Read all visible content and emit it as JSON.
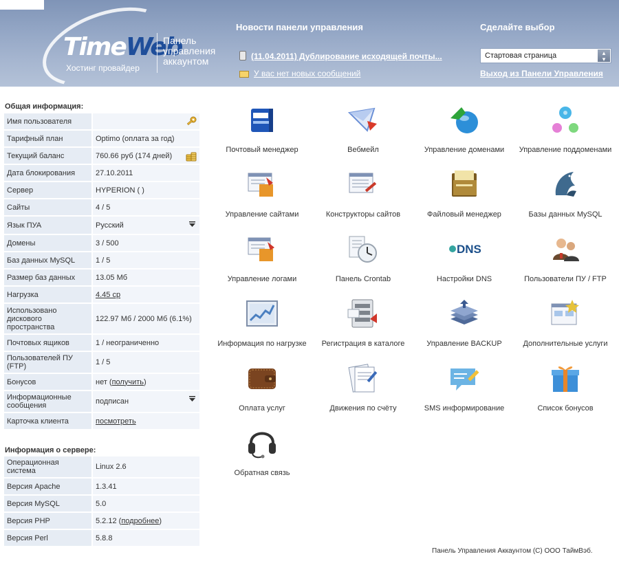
{
  "header": {
    "logo_time": "Time",
    "logo_web": "Web",
    "logo_sub": "Хостинг провайдер",
    "panel_title": "Панель управления аккаунтом",
    "news_title": "Новости панели управления",
    "news_item": "(11.04.2011) Дублирование исходящей почты...",
    "messages": "У вас нет новых сообщений",
    "choose_title": "Сделайте выбор",
    "select_value": "Стартовая страница",
    "logout": "Выход из Панели Управления"
  },
  "general": {
    "title": "Общая информация:",
    "rows": [
      {
        "k": "Имя пользователя",
        "v": ""
      },
      {
        "k": "Тарифный план",
        "v": "Optimo (оплата за год)"
      },
      {
        "k": "Текущий баланс",
        "v": "760.66 руб (174 дней)"
      },
      {
        "k": "Дата блокирования",
        "v": "27.10.2011"
      },
      {
        "k": "Сервер",
        "v": "HYPERION (                    )"
      },
      {
        "k": "Сайты",
        "v": "4 / 5"
      },
      {
        "k": "Язык ПУА",
        "v": "Русский"
      },
      {
        "k": "Домены",
        "v": "3 / 500"
      },
      {
        "k": "Баз данных MySQL",
        "v": "1 / 5"
      },
      {
        "k": "Размер баз данных",
        "v": "13.05 Мб"
      },
      {
        "k": "Нагрузка",
        "v": "4.45 ср"
      },
      {
        "k": "Использовано дискового пространства",
        "v": "122.97 Мб / 2000 Мб (6.1%)"
      },
      {
        "k": "Почтовых ящиков",
        "v": "1 / неограниченно"
      },
      {
        "k": "Пользователей ПУ (FTP)",
        "v": "1 / 5"
      },
      {
        "k": "Бонусов",
        "v_pre": "нет (",
        "v_link": "получить",
        "v_post": ")"
      },
      {
        "k": "Информационные сообщения",
        "v": "подписан"
      },
      {
        "k": "Карточка клиента",
        "v": "посмотреть"
      }
    ]
  },
  "server": {
    "title": "Информация о сервере:",
    "rows": [
      {
        "k": "Операционная система",
        "v": "Linux 2.6"
      },
      {
        "k": "Версия Apache",
        "v": "1.3.41"
      },
      {
        "k": "Версия MySQL",
        "v": "5.0"
      },
      {
        "k": "Версия PHP",
        "v_pre": "5.2.12 (",
        "v_link": "подробнее",
        "v_post": ")"
      },
      {
        "k": "Версия Perl",
        "v": "5.8.8"
      }
    ]
  },
  "tiles": [
    {
      "label": "Почтовый менеджер",
      "icon": "mail-manager-icon",
      "color": "#1f56b8"
    },
    {
      "label": "Вебмейл",
      "icon": "webmail-icon",
      "color": "#6a8fd6"
    },
    {
      "label": "Управление доменами",
      "icon": "domains-icon",
      "color": "#2d8fd8"
    },
    {
      "label": "Управление поддоменами",
      "icon": "subdomains-icon",
      "color": "#49b6e8"
    },
    {
      "label": "Управление сайтами",
      "icon": "sites-icon",
      "color": "#e8962a"
    },
    {
      "label": "Конструкторы сайтов",
      "icon": "site-builder-icon",
      "color": "#c93a2a"
    },
    {
      "label": "Файловый менеджер",
      "icon": "file-manager-icon",
      "color": "#7a5a20"
    },
    {
      "label": "Базы данных MySQL",
      "icon": "mysql-icon",
      "color": "#3f6a8e"
    },
    {
      "label": "Управление логами",
      "icon": "logs-icon",
      "color": "#e8962a"
    },
    {
      "label": "Панель Crontab",
      "icon": "crontab-icon",
      "color": "#9aa4b0"
    },
    {
      "label": "Настройки DNS",
      "icon": "dns-icon",
      "color": "#1b4f8a"
    },
    {
      "label": "Пользователи ПУ / FTP",
      "icon": "users-icon",
      "color": "#6b4a2f"
    },
    {
      "label": "Информация по нагрузке",
      "icon": "load-chart-icon",
      "color": "#4a7fc0"
    },
    {
      "label": "Регистрация в каталоге",
      "icon": "catalog-icon",
      "color": "#7e848c"
    },
    {
      "label": "Управление BACKUP",
      "icon": "backup-icon",
      "color": "#4f6a99"
    },
    {
      "label": "Дополнительные услуги",
      "icon": "extra-services-icon",
      "color": "#e6c23a"
    },
    {
      "label": "Оплата услуг",
      "icon": "payment-icon",
      "color": "#7a4420"
    },
    {
      "label": "Движения по счёту",
      "icon": "account-movements-icon",
      "color": "#3a6ab8"
    },
    {
      "label": "SMS информирование",
      "icon": "sms-icon",
      "color": "#6cb4e4"
    },
    {
      "label": "Список бонусов",
      "icon": "gift-icon",
      "color": "#3d8fd8"
    },
    {
      "label": "Обратная связь",
      "icon": "headset-icon",
      "color": "#333333"
    }
  ],
  "footer": "Панель Управления Аккаунтом (С) ООО ТаймВэб."
}
